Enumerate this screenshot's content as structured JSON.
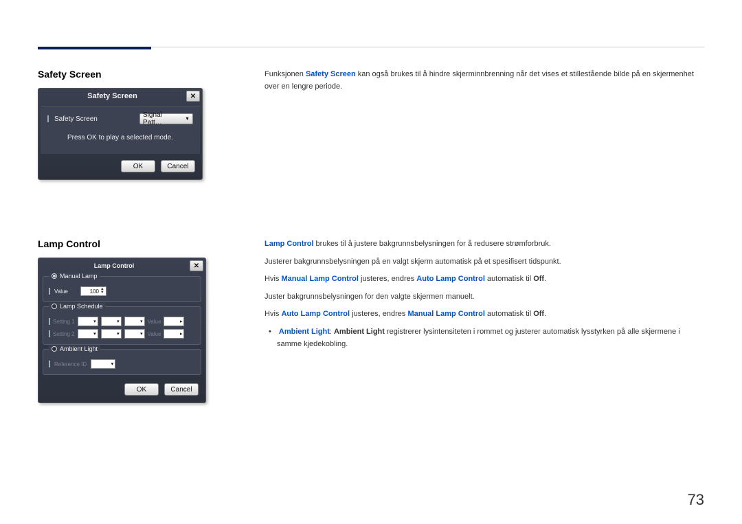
{
  "page_number": "73",
  "sections": {
    "safety": {
      "heading": "Safety Screen",
      "desc_before": "Funksjonen ",
      "desc_key": "Safety Screen",
      "desc_after": " kan også brukes til å hindre skjerminnbrenning når det vises et stillestående bilde på en skjermenhet over en lengre periode.",
      "dialog": {
        "title": "Safety Screen",
        "item_label": "Safety Screen",
        "combo_value": "Signal Patt…",
        "hint": "Press OK to play a selected mode.",
        "ok": "OK",
        "cancel": "Cancel"
      }
    },
    "lamp": {
      "heading": "Lamp Control",
      "p1_key": "Lamp Control",
      "p1_after": " brukes til å justere bakgrunnsbelysningen for å redusere strømforbruk.",
      "p2": "Justerer bakgrunnsbelysningen på en valgt skjerm automatisk på et spesifisert tidspunkt.",
      "p3_before": "Hvis ",
      "p3_k1": "Manual Lamp Control",
      "p3_mid": " justeres, endres ",
      "p3_k2": "Auto Lamp Control",
      "p3_after": " automatisk til ",
      "p3_off": "Off",
      "p4": "Juster bakgrunnsbelysningen for den valgte skjermen manuelt.",
      "p5_before": "Hvis ",
      "p5_k1": "Auto Lamp Control",
      "p5_mid": " justeres, endres ",
      "p5_k2": "Manual Lamp Control",
      "p5_after": " automatisk til ",
      "p5_off": "Off",
      "bullet_k1": "Ambient Light",
      "bullet_sep": ": ",
      "bullet_k2": "Ambient Light",
      "bullet_after": " registrerer lysintensiteten i rommet og justerer automatisk lysstyrken på alle skjermene i samme kjedekobling.",
      "dialog": {
        "title": "Lamp Control",
        "manual_group": "Manual Lamp",
        "value_label": "Value",
        "value": "100",
        "schedule_group": "Lamp Schedule",
        "setting1": "Setting 1",
        "setting2": "Setting 2",
        "sched_value": "Value",
        "ambient_group": "Ambient Light",
        "reference": "Reference ID",
        "ok": "OK",
        "cancel": "Cancel"
      }
    }
  }
}
